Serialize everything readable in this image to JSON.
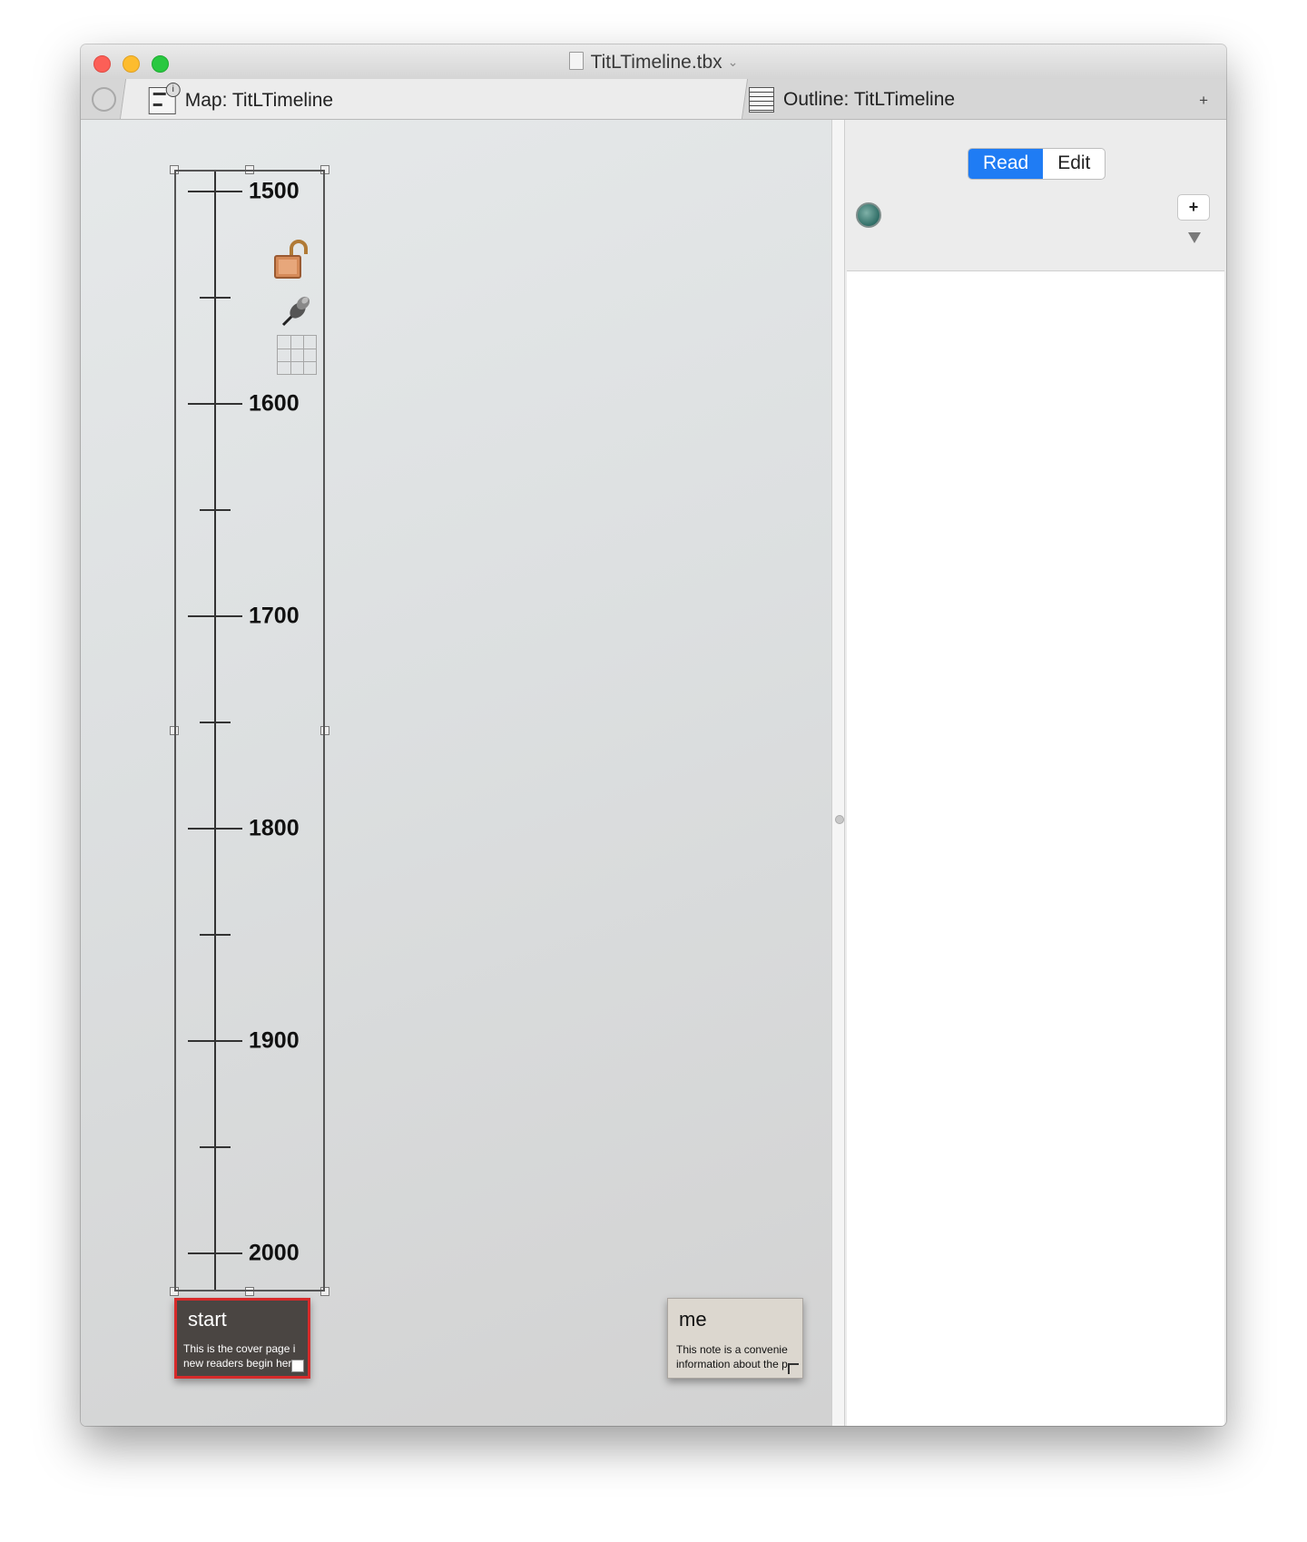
{
  "window": {
    "title": "TitLTimeline.tbx"
  },
  "tabs": [
    {
      "label": "Map: TitLTimeline",
      "icon": "map-view-icon",
      "active": true
    },
    {
      "label": "Outline: TitLTimeline",
      "icon": "outline-view-icon",
      "active": false
    }
  ],
  "tab_add_label": "+",
  "timeline": {
    "major_years": [
      "1500",
      "1600",
      "1700",
      "1800",
      "1900",
      "2000"
    ],
    "minor_tick_count": 5,
    "icons": [
      "unlock-icon",
      "pin-icon",
      "table-grid-icon"
    ]
  },
  "notes": [
    {
      "title": "start",
      "body": "This is the cover page i\nnew readers begin her",
      "selected": true,
      "color": "#4a4542",
      "border_color": "#d62a2a"
    },
    {
      "title": "me",
      "body": "This note is a convenie\ninformation about the p",
      "selected": false,
      "color": "#dcd7cf"
    }
  ],
  "inspector": {
    "read_label": "Read",
    "edit_label": "Edit",
    "active_mode": "Read",
    "plus_label": "+",
    "accent_color": "#1f7cf4"
  }
}
